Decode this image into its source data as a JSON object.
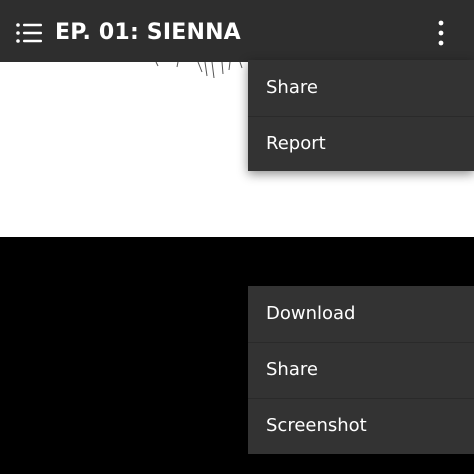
{
  "appbar": {
    "title": "EP. 01: SIENNA",
    "menu_icon": "hamburger-menu-icon",
    "overflow_icon": "more-vertical-icon",
    "background": "#2e2e2e"
  },
  "menu_top": {
    "items": [
      {
        "label": "Share"
      },
      {
        "label": "Report"
      }
    ]
  },
  "menu_bottom": {
    "items": [
      {
        "label": "Download"
      },
      {
        "label": "Share"
      },
      {
        "label": "Screenshot"
      }
    ]
  },
  "colors": {
    "menu_background": "#333333",
    "text": "#ffffff",
    "panel": "#ffffff",
    "viewer_background": "#000000"
  }
}
